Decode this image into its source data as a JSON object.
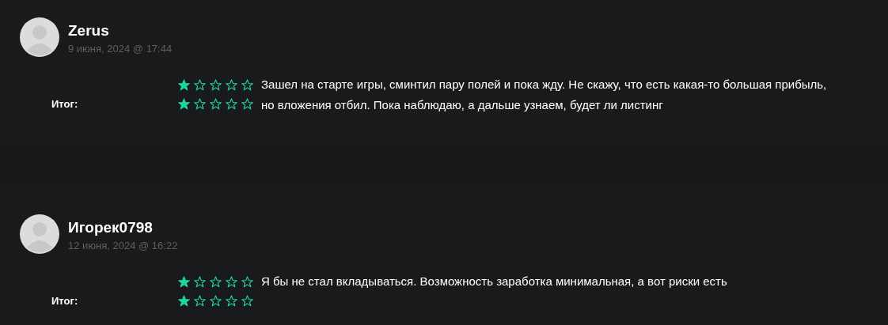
{
  "reviews": [
    {
      "author": "Zerus",
      "date": "9 июня, 2024 @ 17:44",
      "ratings": [
        {
          "stars": 1
        },
        {
          "label": "Итог:",
          "stars": 1
        }
      ],
      "text": "Зашел на старте игры, сминтил пару полей и пока жду. Не скажу, что есть какая-то большая прибыль, но вложения отбил. Пока наблюдаю, а дальше узнаем, будет ли листинг"
    },
    {
      "author": "Игорек0798",
      "date": "12 июня, 2024 @ 16:22",
      "ratings": [
        {
          "stars": 1
        },
        {
          "label": "Итог:",
          "stars": 1
        }
      ],
      "text": "Я бы не стал вкладываться. Возможность заработка минимальная, а вот риски есть"
    }
  ]
}
